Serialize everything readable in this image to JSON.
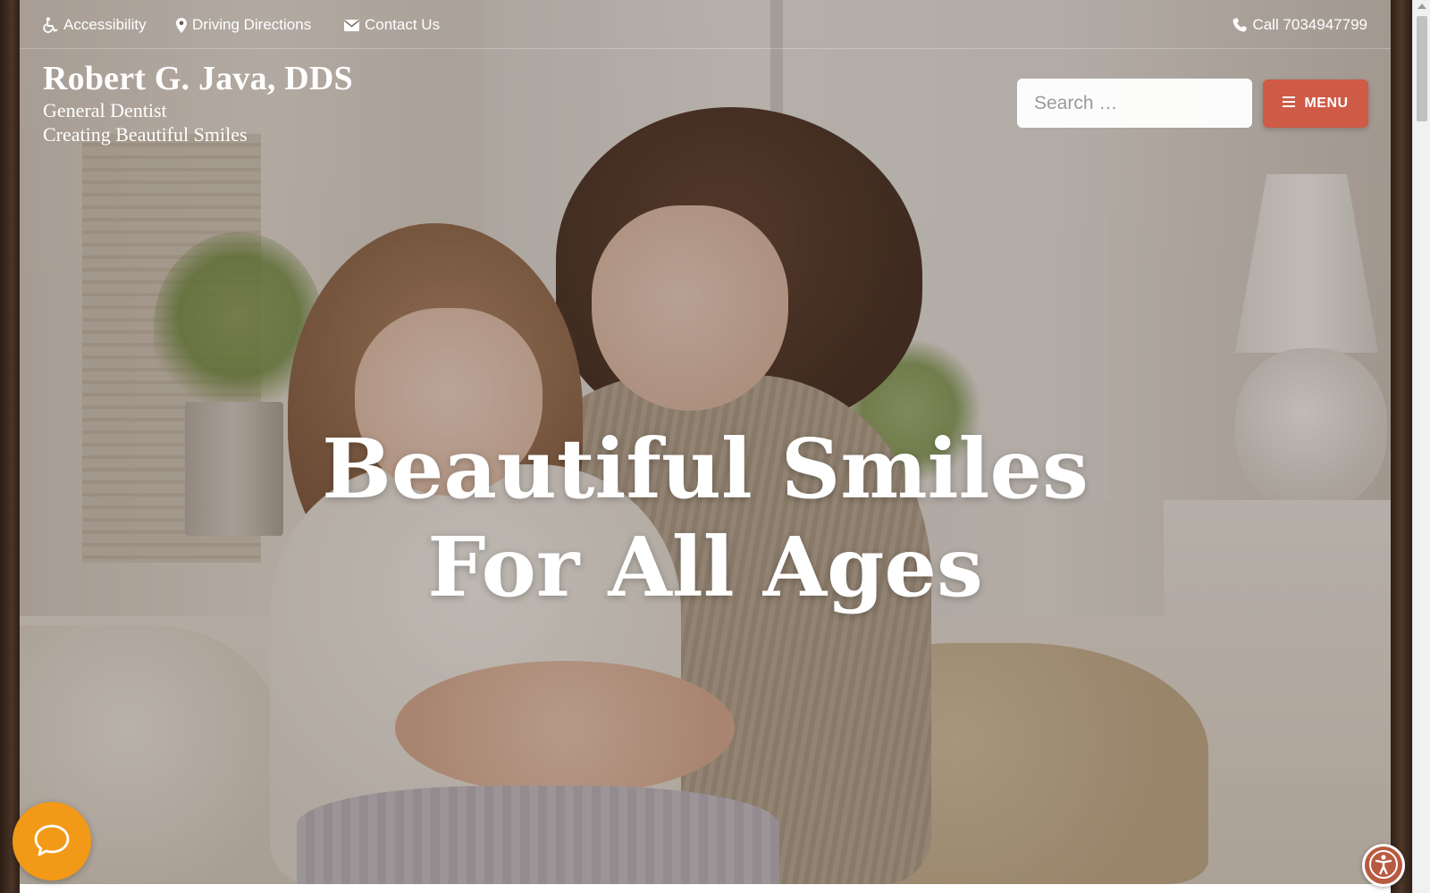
{
  "topbar": {
    "accessibility_label": "Accessibility",
    "directions_label": "Driving Directions",
    "contact_label": "Contact Us",
    "call_label": "Call 7034947799"
  },
  "brand": {
    "name": "Robert G. Java, DDS",
    "specialty": "General Dentist",
    "tagline": "Creating Beautiful Smiles"
  },
  "search": {
    "placeholder": "Search …"
  },
  "menu": {
    "label": "MENU"
  },
  "hero": {
    "headline_line1": "Beautiful Smiles",
    "headline_line2": "For All Ages"
  },
  "icons": {
    "accessibility": "wheelchair-icon",
    "directions": "map-marker-icon",
    "contact": "envelope-icon",
    "call": "phone-icon",
    "search": "search-icon",
    "menu": "hamburger-icon",
    "chat": "chat-bubble-icon",
    "a11y_widget": "accessibility-person-icon"
  },
  "colors": {
    "menu_button": "#cf5a45",
    "chat_button": "#f29a17",
    "a11y_button": "#b85a40",
    "text_on_hero": "#ffffff"
  }
}
